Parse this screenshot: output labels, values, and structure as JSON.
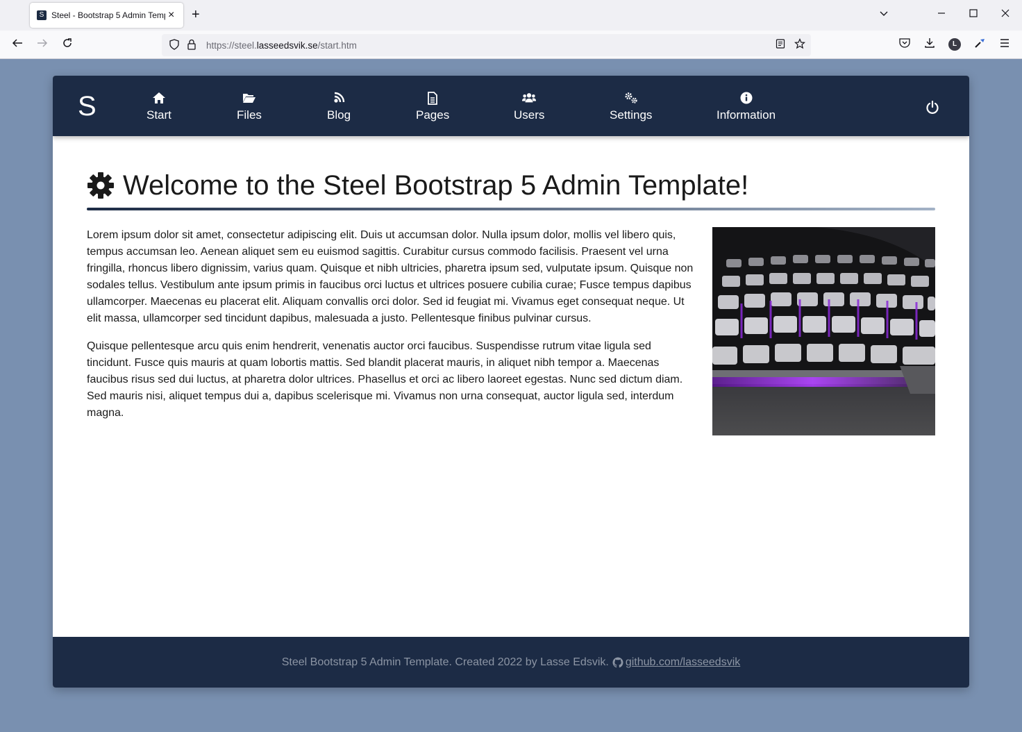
{
  "browser": {
    "tab_title": "Steel - Bootstrap 5 Admin Temp",
    "tab_favicon_letter": "S",
    "url_scheme": "https://steel.",
    "url_host": "lasseedsvik.se",
    "url_path": "/start.htm",
    "account_initial": "L"
  },
  "nav": {
    "brand": "S",
    "items": [
      {
        "label": "Start",
        "icon": "home-icon"
      },
      {
        "label": "Files",
        "icon": "folder-open-icon"
      },
      {
        "label": "Blog",
        "icon": "rss-icon"
      },
      {
        "label": "Pages",
        "icon": "file-icon"
      },
      {
        "label": "Users",
        "icon": "users-icon"
      },
      {
        "label": "Settings",
        "icon": "cogs-icon"
      },
      {
        "label": "Information",
        "icon": "info-circle-icon"
      }
    ],
    "power_icon": "power-icon"
  },
  "main": {
    "heading": "Welcome to the Steel Bootstrap 5 Admin Template!",
    "paragraphs": [
      "Lorem ipsum dolor sit amet, consectetur adipiscing elit. Duis ut accumsan dolor. Nulla ipsum dolor, mollis vel libero quis, tempus accumsan leo. Aenean aliquet sem eu euismod sagittis. Curabitur cursus commodo facilisis. Praesent vel urna fringilla, rhoncus libero dignissim, varius quam. Quisque et nibh ultricies, pharetra ipsum sed, vulputate ipsum. Quisque non sodales tellus. Vestibulum ante ipsum primis in faucibus orci luctus et ultrices posuere cubilia curae; Fusce tempus dapibus ullamcorper. Maecenas eu placerat elit. Aliquam convallis orci dolor. Sed id feugiat mi. Vivamus eget consequat neque. Ut elit massa, ullamcorper sed tincidunt dapibus, malesuada a justo. Pellentesque finibus pulvinar cursus.",
      "Quisque pellentesque arcu quis enim hendrerit, venenatis auctor orci faucibus. Suspendisse rutrum vitae ligula sed tincidunt. Fusce quis mauris at quam lobortis mattis. Sed blandit placerat mauris, in aliquet nibh tempor a. Maecenas faucibus risus sed dui luctus, at pharetra dolor ultrices. Phasellus et orci ac libero laoreet egestas. Nunc sed dictum diam. Sed mauris nisi, aliquet tempus dui a, dapibus scelerisque mi. Vivamus non urna consequat, auctor ligula sed, interdum magna."
    ]
  },
  "footer": {
    "text": "Steel Bootstrap 5 Admin Template. Created 2022 by Lasse Edsvik.",
    "link": "github.com/lasseedsvik"
  },
  "colors": {
    "nav_bg": "#1c2b45",
    "page_bg": "#7990b0",
    "keyboard_glow": "#a020f0"
  }
}
